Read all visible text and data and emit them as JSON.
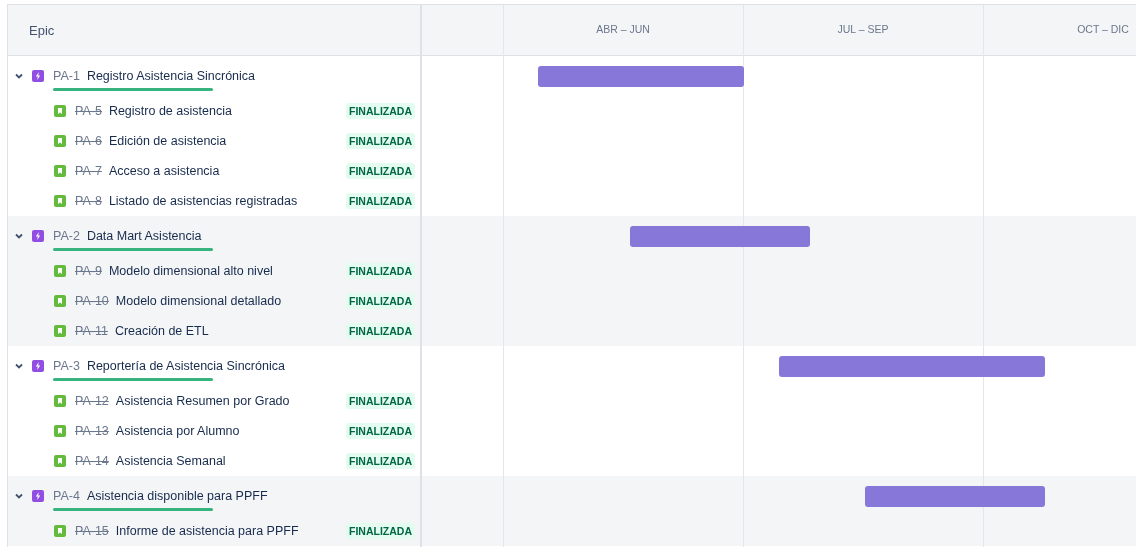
{
  "header": {
    "column_label": "Epic"
  },
  "timeline": {
    "quarters": [
      {
        "label": "ABR – JUN"
      },
      {
        "label": "JUL – SEP"
      },
      {
        "label": "OCT – DIC"
      }
    ]
  },
  "epics": [
    {
      "key": "PA-1",
      "title": "Registro Asistencia Sincrónica",
      "expanded": true,
      "children": [
        {
          "key": "PA-5",
          "title": "Registro de asistencia",
          "done": true,
          "status": "FINALIZADA"
        },
        {
          "key": "PA-6",
          "title": "Edición de asistencia",
          "done": true,
          "status": "FINALIZADA"
        },
        {
          "key": "PA-7",
          "title": "Acceso a asistencia",
          "done": true,
          "status": "FINALIZADA"
        },
        {
          "key": "PA-8",
          "title": "Listado de asistencias registradas",
          "done": true,
          "status": "FINALIZADA"
        }
      ]
    },
    {
      "key": "PA-2",
      "title": "Data Mart Asistencia",
      "expanded": true,
      "children": [
        {
          "key": "PA-9",
          "title": "Modelo dimensional alto nivel",
          "done": true,
          "status": "FINALIZADA"
        },
        {
          "key": "PA-10",
          "title": "Modelo dimensional detallado",
          "done": true,
          "status": "FINALIZADA"
        },
        {
          "key": "PA-11",
          "title": "Creación de ETL",
          "done": true,
          "status": "FINALIZADA"
        }
      ]
    },
    {
      "key": "PA-3",
      "title": "Reportería de Asistencia Sincrónica",
      "expanded": true,
      "children": [
        {
          "key": "PA-12",
          "title": "Asistencia Resumen por Grado",
          "done": true,
          "status": "FINALIZADA"
        },
        {
          "key": "PA-13",
          "title": "Asistencia por Alumno",
          "done": true,
          "status": "FINALIZADA"
        },
        {
          "key": "PA-14",
          "title": "Asistencia Semanal",
          "done": true,
          "status": "FINALIZADA"
        }
      ]
    },
    {
      "key": "PA-4",
      "title": "Asistencia disponible para PPFF",
      "expanded": true,
      "children": [
        {
          "key": "PA-15",
          "title": "Informe de asistencia para PPFF",
          "done": true,
          "status": "FINALIZADA"
        }
      ]
    }
  ]
}
